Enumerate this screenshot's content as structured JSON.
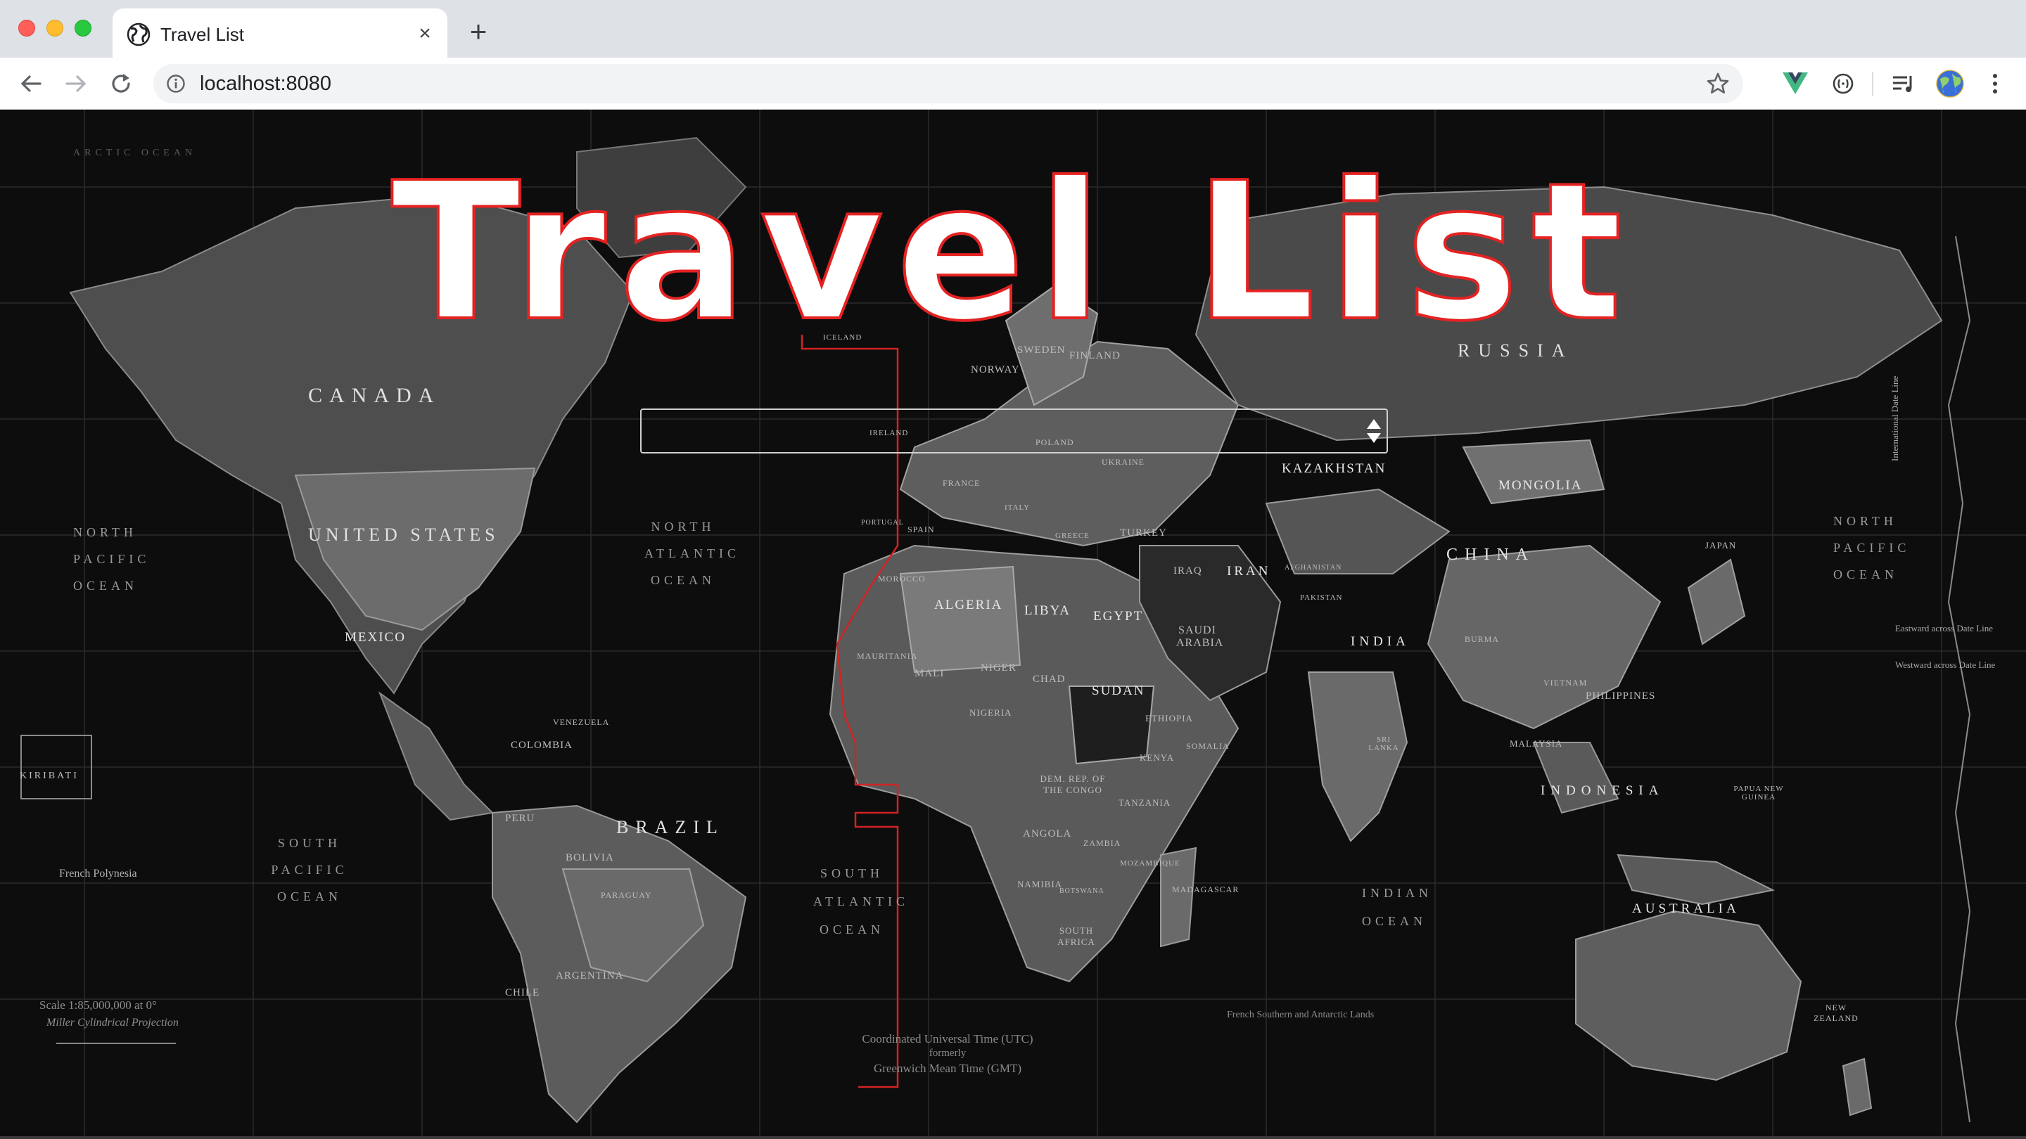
{
  "browser": {
    "tab_title": "Travel List",
    "tab_close": "×",
    "new_tab": "+",
    "url": "localhost:8080"
  },
  "page": {
    "title": "Travel List",
    "search": {
      "value": "",
      "placeholder": ""
    }
  },
  "map": {
    "countries": [
      {
        "name": "CANADA"
      },
      {
        "name": "UNITED STATES"
      },
      {
        "name": "MEXICO"
      },
      {
        "name": "BRAZIL"
      },
      {
        "name": "ARGENTINA"
      },
      {
        "name": "PERU"
      },
      {
        "name": "BOLIVIA"
      },
      {
        "name": "COLOMBIA"
      },
      {
        "name": "VENEZUELA"
      },
      {
        "name": "CHILE"
      },
      {
        "name": "PARAGUAY"
      },
      {
        "name": "RUSSIA"
      },
      {
        "name": "KAZAKHSTAN"
      },
      {
        "name": "MONGOLIA"
      },
      {
        "name": "CHINA"
      },
      {
        "name": "INDIA"
      },
      {
        "name": "IRAN"
      },
      {
        "name": "SAUDI ARABIA"
      },
      {
        "name": "TURKEY"
      },
      {
        "name": "IRAQ"
      },
      {
        "name": "AFGHANISTAN"
      },
      {
        "name": "PAKISTAN"
      },
      {
        "name": "ALGERIA"
      },
      {
        "name": "LIBYA"
      },
      {
        "name": "EGYPT"
      },
      {
        "name": "SUDAN"
      },
      {
        "name": "MALI"
      },
      {
        "name": "NIGER"
      },
      {
        "name": "CHAD"
      },
      {
        "name": "NIGERIA"
      },
      {
        "name": "ETHIOPIA"
      },
      {
        "name": "KENYA"
      },
      {
        "name": "SOMALIA"
      },
      {
        "name": "TANZANIA"
      },
      {
        "name": "ANGOLA"
      },
      {
        "name": "NAMIBIA"
      },
      {
        "name": "ZAMBIA"
      },
      {
        "name": "SOUTH AFRICA"
      },
      {
        "name": "MADAGASCAR"
      },
      {
        "name": "MOROCCO"
      },
      {
        "name": "MAURITANIA"
      },
      {
        "name": "MOZAMBIQUE"
      },
      {
        "name": "BOTSWANA"
      },
      {
        "name": "DEM. REP. OF THE CONGO"
      },
      {
        "name": "FINLAND"
      },
      {
        "name": "SWEDEN"
      },
      {
        "name": "NORWAY"
      },
      {
        "name": "UKRAINE"
      },
      {
        "name": "POLAND"
      },
      {
        "name": "FRANCE"
      },
      {
        "name": "SPAIN"
      },
      {
        "name": "PORTUGAL"
      },
      {
        "name": "ITALY"
      },
      {
        "name": "GREECE"
      },
      {
        "name": "ICELAND"
      },
      {
        "name": "IRELAND"
      },
      {
        "name": "INDONESIA"
      },
      {
        "name": "MALAYSIA"
      },
      {
        "name": "PHILIPPINES"
      },
      {
        "name": "VIETNAM"
      },
      {
        "name": "BURMA"
      },
      {
        "name": "JAPAN"
      },
      {
        "name": "AUSTRALIA"
      },
      {
        "name": "NEW ZEALAND"
      },
      {
        "name": "KIRIBATI"
      },
      {
        "name": "SRI LANKA"
      },
      {
        "name": "PAPUA NEW GUINEA"
      }
    ],
    "oceans": [
      "NORTH PACIFIC OCEAN",
      "NORTH ATLANTIC OCEAN",
      "SOUTH PACIFIC OCEAN",
      "SOUTH ATLANTIC OCEAN",
      "INDIAN OCEAN",
      "NORTH PACIFIC OCEAN",
      "ARCTIC OCEAN"
    ],
    "notes": {
      "scale": "Scale 1:85,000,000 at 0°",
      "projection": "Miller Cylindrical Projection",
      "utc_line1": "Coordinated Universal Time (UTC)",
      "utc_line2": "formerly",
      "utc_line3": "Greenwich Mean Time (GMT)",
      "eastward": "Eastward across Date Line",
      "westward": "Westward across Date Line",
      "dateline": "International Date Line",
      "french_polynesia": "French Polynesia",
      "french_southern": "French Southern and Antarctic Lands"
    }
  },
  "icons": {
    "favicon": "globe-icon",
    "back": "arrow-left-icon",
    "forward": "arrow-right-icon",
    "reload": "reload-icon",
    "info": "info-icon",
    "star": "star-icon",
    "vue": "vue-devtools-icon",
    "ext": "extension-icon",
    "media": "media-queue-icon",
    "profile": "profile-avatar-icon",
    "menu": "kebab-menu-icon"
  },
  "colors": {
    "title_stroke": "#e52222",
    "background": "#0d0d0d",
    "vue": "#41b883"
  }
}
